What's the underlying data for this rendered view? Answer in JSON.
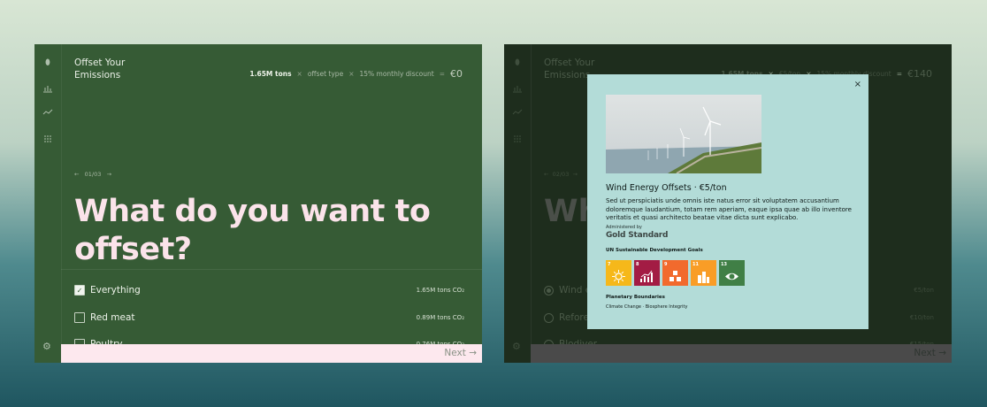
{
  "app": {
    "title_line1": "Offset Your",
    "title_line2": "Emissions"
  },
  "left": {
    "summary": {
      "amount": "1.65M tons",
      "sep1": "×",
      "type": "offset type",
      "sep2": "×",
      "discount": "15% monthly discount",
      "sep3": "=",
      "price": "€0"
    },
    "step": "01/03",
    "headline": "What do you want to offset?",
    "options": [
      {
        "label": "Everything",
        "value": "1.65M tons CO₂",
        "checked": true
      },
      {
        "label": "Red meat",
        "value": "0.89M tons CO₂",
        "checked": false
      },
      {
        "label": "Poultry",
        "value": "0.76M tons CO₂",
        "checked": false
      }
    ],
    "next_label": "Next"
  },
  "right": {
    "summary": {
      "amount": "1.65M tons",
      "sep1": "×",
      "type": "€5/ton",
      "sep2": "×",
      "discount": "15% monthly discount",
      "sep3": "=",
      "price": "€140"
    },
    "step": "02/03",
    "headline": "Wh... s do you ...?",
    "options": [
      {
        "label": "Wind e",
        "value": "€5/ton",
        "selected": true
      },
      {
        "label": "Refore",
        "value": "€10/ton",
        "selected": false
      },
      {
        "label": "Blodiver",
        "value": "€15/ton",
        "selected": false
      }
    ],
    "next_label": "Next"
  },
  "modal": {
    "close": "×",
    "title": "Wind Energy Offsets",
    "dot": "·",
    "price": "€5/ton",
    "description": "Sed ut perspiciatis unde omnis iste natus error sit voluptatem accusantium doloremque laudantium, totam rem aperiam, eaque ipsa quae ab illo inventore veritatis et quasi architecto beatae vitae dicta sunt explicabo.",
    "administered_label": "Administered by",
    "administrator": "Gold Standard",
    "sdg_heading": "UN Sustainable Development Goals",
    "sdgs": [
      {
        "num": "7",
        "color": "#f6b81a",
        "icon": "sun-icon"
      },
      {
        "num": "8",
        "color": "#a31c44",
        "icon": "growth-chart-icon"
      },
      {
        "num": "9",
        "color": "#f26a2d",
        "icon": "industry-cubes-icon"
      },
      {
        "num": "11",
        "color": "#f99d26",
        "icon": "city-buildings-icon"
      },
      {
        "num": "13",
        "color": "#407f46",
        "icon": "eye-globe-icon"
      }
    ],
    "pb_heading": "Planetary Boundaries",
    "pb_text": "Climate Change · Biosphere Integrity"
  },
  "colors": {
    "left_panel": "#365b35",
    "headline_pink": "#fbe3ea",
    "modal_bg": "#b3dcd8",
    "footer_pink": "#fde8ee"
  }
}
